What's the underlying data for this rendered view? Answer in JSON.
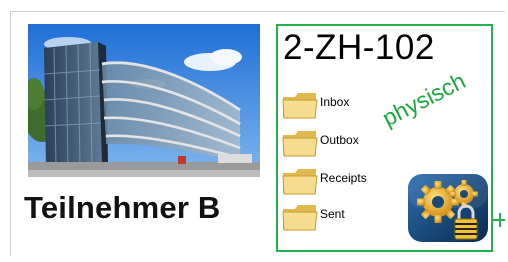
{
  "participant": {
    "label": "Teilnehmer B"
  },
  "mailbox": {
    "id": "2-ZH-102",
    "type_label": "physisch",
    "folders": [
      {
        "label": "Inbox",
        "icon": "folder-icon"
      },
      {
        "label": "Outbox",
        "icon": "folder-icon"
      },
      {
        "label": "Receipts",
        "icon": "folder-icon"
      },
      {
        "label": "Sent",
        "icon": "folder-icon"
      }
    ]
  },
  "colors": {
    "panel_border": "#22b14c",
    "type_label": "#1aaa3c",
    "folder_fill": "#f3d98a"
  },
  "icons": [
    "building-photo",
    "folder-icon",
    "gears-lock-icon"
  ]
}
